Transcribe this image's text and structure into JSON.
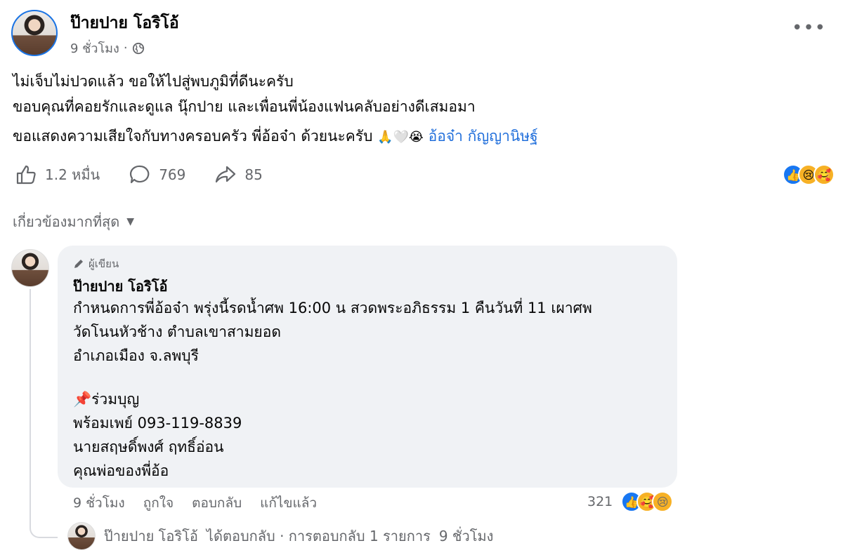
{
  "post": {
    "author": "ป๊ายปาย โอริโอ้",
    "time": "9 ชั่วโมง",
    "separator": "·",
    "privacy_icon": "globe-icon",
    "lines": [
      "ไม่เจ็บไม่ปวดแล้ว ขอให้ไปสู่พบภูมิที่ดีนะครับ",
      "ขอบคุณที่คอยรักและดูแล นุ๊กปาย และเพื่อนพี่น้องแฟนคลับอย่างดีเสมอมา"
    ],
    "condolence": "ขอแสดงความเสียใจกับทางครอบครัว พี่อ้อจ๋า ด้วยนะครับ",
    "emojis": "🙏🤍😭",
    "tag": "อ้อจ๋า กัญญานิษฐ์"
  },
  "actions": {
    "likes": "1.2 หมื่น",
    "comments": "769",
    "shares": "85"
  },
  "reactions": [
    "like",
    "sad",
    "care"
  ],
  "sort": {
    "label": "เกี่ยวข้องมากที่สุด"
  },
  "comment": {
    "badge": "ผู้เขียน",
    "author": "ป๊ายปาย โอริโอ้",
    "lines": [
      "กำหนดการพี่อ้อจ๋า พรุ่งนี้รดน้ำศพ 16:00 น สวดพระอภิธรรม 1 คืนวันที่ 11 เผาศพ",
      "วัดโนนหัวช้าง ตำบลเขาสามยอด",
      "อำเภอเมือง จ.ลพบุรี"
    ],
    "pin": "📌",
    "lines2": [
      "ร่วมบุญ",
      "พร้อมเพย์ 093-119-8839",
      "นายสฤษดิ์พงศ์ ฤทธิ์อ่อน",
      "คุณพ่อของพี่อ้อ"
    ],
    "time": "9 ชั่วโมง",
    "like_label": "ถูกใจ",
    "reply_label": "ตอบกลับ",
    "edited_label": "แก้ไขแล้ว",
    "reaction_count": "321"
  },
  "reply": {
    "author": "ป๊ายปาย โอริโอ้",
    "text": "ได้ตอบกลับ · การตอบกลับ 1 รายการ",
    "time": "9 ชั่วโมง"
  },
  "colors": {
    "link": "#216fdb",
    "muted": "#65676b",
    "bubble": "#f0f2f5",
    "like_blue": "#1877f2"
  }
}
